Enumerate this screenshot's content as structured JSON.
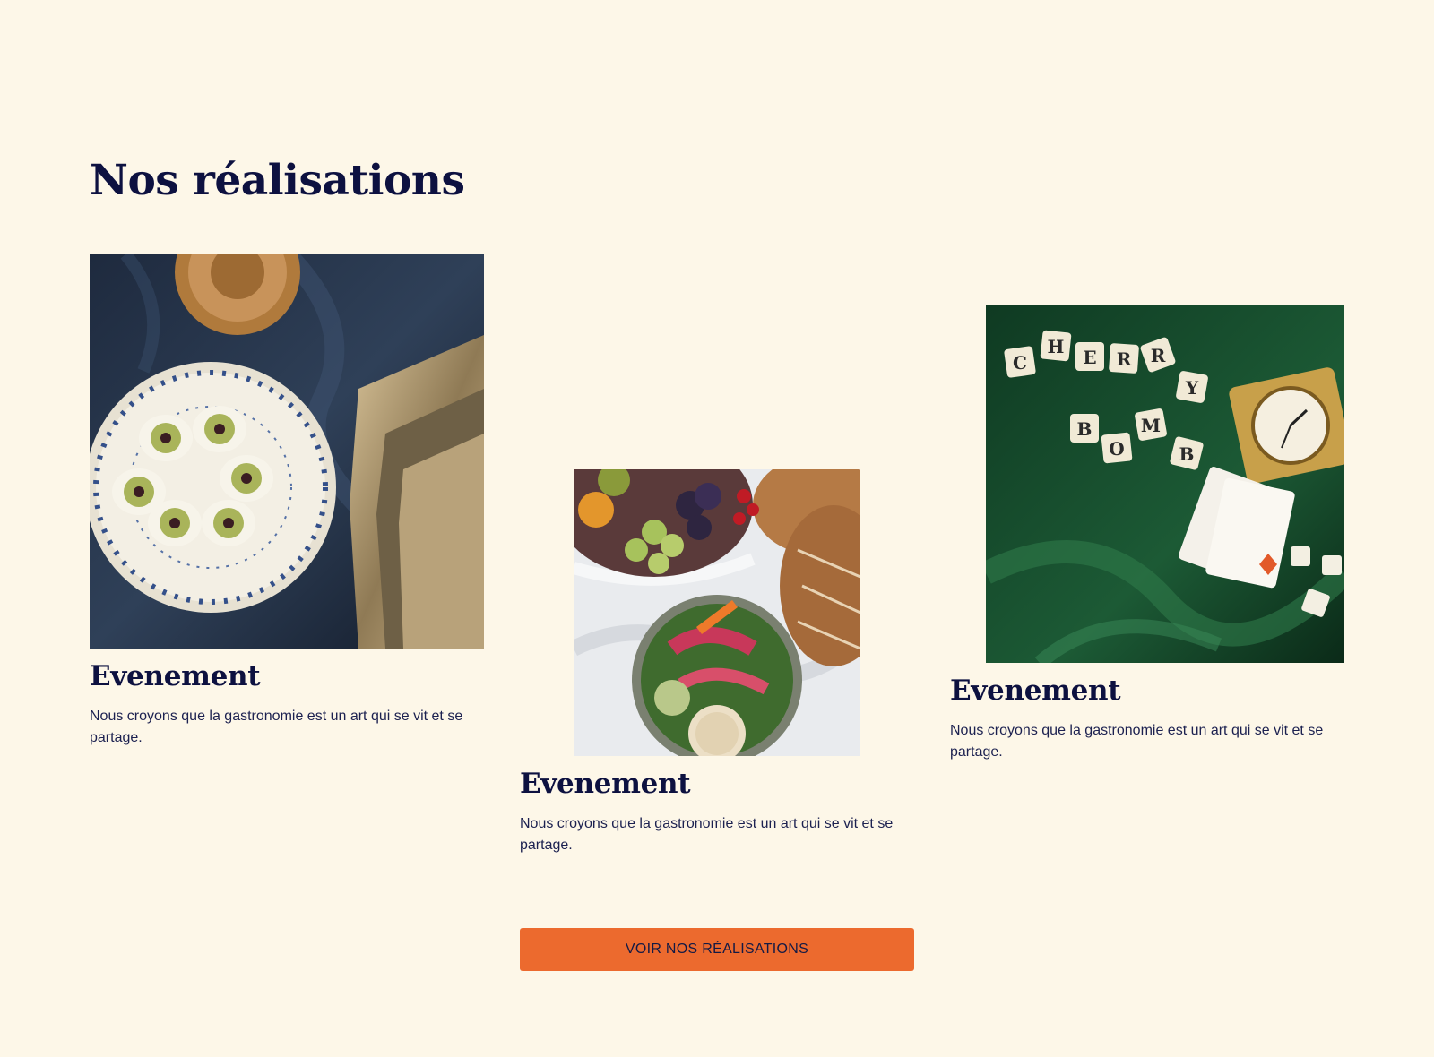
{
  "section": {
    "title": "Nos réalisations"
  },
  "cards": [
    {
      "image": "deviled-eggs-plate-photo",
      "title": "Evenement",
      "description": "Nous croyons que la gastronomie est un art qui se vit et se partage."
    },
    {
      "image": "fruit-bread-crudites-photo",
      "title": "Evenement",
      "description": "Nous croyons que la gastronomie est un art qui se vit et se partage."
    },
    {
      "image": "cherry-bomb-letter-tiles-photo",
      "title": "Evenement",
      "description": "Nous croyons que la gastronomie est un art qui se vit et se partage."
    }
  ],
  "cta": {
    "label": "VOIR NOS RÉALISATIONS"
  },
  "colors": {
    "background": "#fdf7e8",
    "heading": "#0d1140",
    "accent": "#ec6a2e"
  }
}
